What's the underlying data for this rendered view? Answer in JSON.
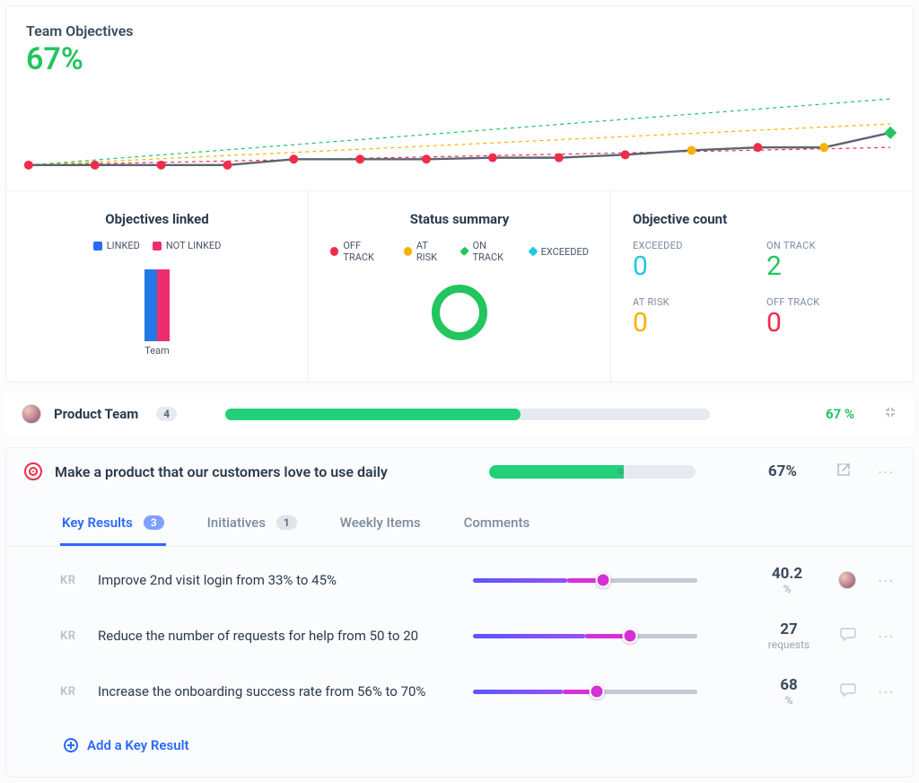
{
  "chart": {
    "title": "Team Objectives",
    "percent": "67%",
    "legend": {
      "linked": "LINKED",
      "not_linked": "NOT LINKED",
      "off_track": "OFF TRACK",
      "at_risk": "AT RISK",
      "on_track": "ON TRACK",
      "exceeded": "EXCEEDED"
    }
  },
  "chart_data": {
    "type": "line",
    "x": [
      0,
      1,
      2,
      3,
      4,
      5,
      6,
      7,
      8,
      9,
      10,
      11,
      12,
      13
    ],
    "series": [
      {
        "name": "Progress",
        "values": [
          30,
          30,
          30,
          30,
          34,
          34,
          34,
          35,
          35,
          37,
          40,
          42,
          42,
          52
        ],
        "point_status": [
          "off",
          "off",
          "off",
          "off",
          "off",
          "off",
          "off",
          "off",
          "off",
          "off",
          "risk",
          "off",
          "risk",
          "on"
        ]
      }
    ],
    "guides": [
      {
        "name": "on_track_target",
        "style": "dashed",
        "color": "#22c55e",
        "start": 30,
        "end": 75
      },
      {
        "name": "at_risk_target",
        "style": "dashed",
        "color": "#f5b301",
        "start": 30,
        "end": 58
      },
      {
        "name": "off_track_target",
        "style": "dashed",
        "color": "#ef2d4b",
        "start": 30,
        "end": 42
      }
    ],
    "ylim": [
      25,
      80
    ]
  },
  "summary": {
    "linked_title": "Objectives linked",
    "linked_axis_label": "Team",
    "status_title": "Status summary",
    "count_title": "Objective count",
    "counts": {
      "exceeded_label": "EXCEEDED",
      "exceeded_val": "0",
      "ontrack_label": "ON TRACK",
      "ontrack_val": "2",
      "atrisk_label": "AT RISK",
      "atrisk_val": "0",
      "offtrack_label": "OFF TRACK",
      "offtrack_val": "0"
    }
  },
  "team": {
    "name": "Product Team",
    "count": "4",
    "percent": "67 %",
    "progress_pct": 61
  },
  "objective": {
    "title": "Make a product that our customers love to use daily",
    "percent": "67%",
    "progress_pct": 65,
    "tabs": {
      "key_results": "Key Results",
      "key_results_count": "3",
      "initiatives": "Initiatives",
      "initiatives_count": "1",
      "weekly_items": "Weekly Items",
      "comments": "Comments"
    }
  },
  "krs": [
    {
      "tag": "KR",
      "title": "Improve 2nd visit login from 33% to 45%",
      "value": "40.2",
      "unit": "%",
      "base_pct": 42,
      "fill_pct": 58,
      "has_avatar": true
    },
    {
      "tag": "KR",
      "title": "Reduce the number of requests for help from 50 to 20",
      "value": "27",
      "unit": "requests",
      "base_pct": 50,
      "fill_pct": 70,
      "has_avatar": false
    },
    {
      "tag": "KR",
      "title": "Increase the onboarding success rate from 56% to 70%",
      "value": "68",
      "unit": "%",
      "base_pct": 40,
      "fill_pct": 55,
      "has_avatar": false
    }
  ],
  "add_kr_label": "Add a Key Result"
}
